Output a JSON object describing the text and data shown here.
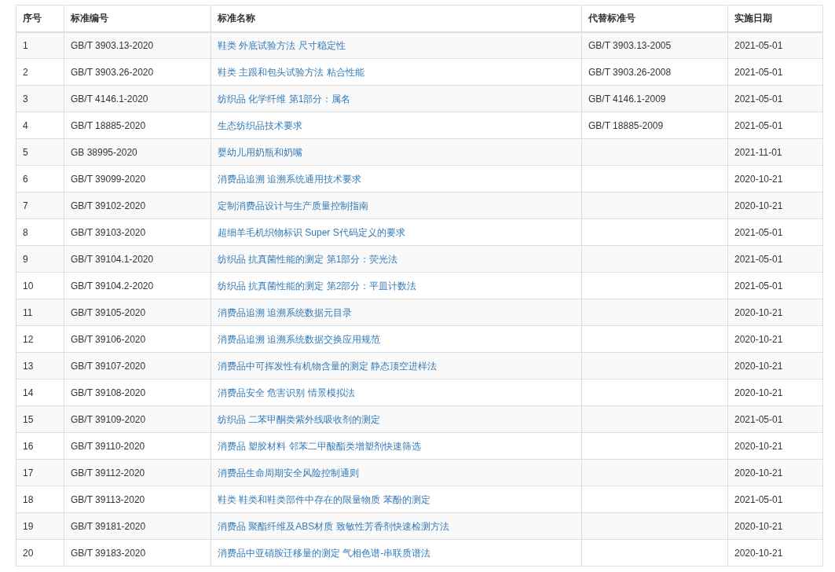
{
  "table": {
    "columns": [
      "序号",
      "标准编号",
      "标准名称",
      "代替标准号",
      "实施日期"
    ],
    "rows": [
      {
        "no": "1",
        "code": "GB/T 3903.13-2020",
        "name": "鞋类 外底试验方法 尺寸稳定性",
        "replaces": "GB/T 3903.13-2005",
        "date": "2021-05-01"
      },
      {
        "no": "2",
        "code": "GB/T 3903.26-2020",
        "name": "鞋类 主跟和包头试验方法 粘合性能",
        "replaces": "GB/T 3903.26-2008",
        "date": "2021-05-01"
      },
      {
        "no": "3",
        "code": "GB/T 4146.1-2020",
        "name": "纺织品 化学纤维 第1部分：属名",
        "replaces": "GB/T 4146.1-2009",
        "date": "2021-05-01"
      },
      {
        "no": "4",
        "code": "GB/T 18885-2020",
        "name": "生态纺织品技术要求",
        "replaces": "GB/T 18885-2009",
        "date": "2021-05-01"
      },
      {
        "no": "5",
        "code": "GB 38995-2020",
        "name": "婴幼儿用奶瓶和奶嘴",
        "date": "2021-11-01"
      },
      {
        "no": "6",
        "code": "GB/T 39099-2020",
        "name": "消费品追溯 追溯系统通用技术要求",
        "date": "2020-10-21"
      },
      {
        "no": "7",
        "code": "GB/T 39102-2020",
        "name": "定制消费品设计与生产质量控制指南",
        "date": "2020-10-21"
      },
      {
        "no": "8",
        "code": "GB/T 39103-2020",
        "name": "超细羊毛机织物标识 Super S代码定义的要求",
        "date": "2021-05-01"
      },
      {
        "no": "9",
        "code": "GB/T 39104.1-2020",
        "name": "纺织品 抗真菌性能的测定 第1部分：荧光法",
        "date": "2021-05-01"
      },
      {
        "no": "10",
        "code": "GB/T 39104.2-2020",
        "name": "纺织品 抗真菌性能的测定 第2部分：平皿计数法",
        "date": "2021-05-01"
      },
      {
        "no": "11",
        "code": "GB/T 39105-2020",
        "name": "消费品追溯 追溯系统数据元目录",
        "date": "2020-10-21"
      },
      {
        "no": "12",
        "code": "GB/T 39106-2020",
        "name": "消费品追溯 追溯系统数据交换应用规范",
        "date": "2020-10-21"
      },
      {
        "no": "13",
        "code": "GB/T 39107-2020",
        "name": "消费品中可挥发性有机物含量的测定 静态顶空进样法",
        "date": "2020-10-21"
      },
      {
        "no": "14",
        "code": "GB/T 39108-2020",
        "name": "消费品安全 危害识别 情景模拟法",
        "date": "2020-10-21"
      },
      {
        "no": "15",
        "code": "GB/T 39109-2020",
        "name": "纺织品 二苯甲酮类紫外线吸收剂的测定",
        "date": "2021-05-01"
      },
      {
        "no": "16",
        "code": "GB/T 39110-2020",
        "name": "消费品 塑胶材料 邻苯二甲酸酯类增塑剂快速筛选",
        "date": "2020-10-21"
      },
      {
        "no": "17",
        "code": "GB/T 39112-2020",
        "name": "消费品生命周期安全风险控制通则",
        "date": "2020-10-21"
      },
      {
        "no": "18",
        "code": "GB/T 39113-2020",
        "name": "鞋类 鞋类和鞋类部件中存在的限量物质 苯酚的测定",
        "date": "2021-05-01"
      },
      {
        "no": "19",
        "code": "GB/T 39181-2020",
        "name": "消费品 聚酯纤维及ABS材质 致敏性芳香剂快速检测方法",
        "date": "2020-10-21"
      },
      {
        "no": "20",
        "code": "GB/T 39183-2020",
        "name": "消费品中亚硝胺迁移量的测定 气相色谱-串联质谱法",
        "date": "2020-10-21"
      }
    ]
  }
}
